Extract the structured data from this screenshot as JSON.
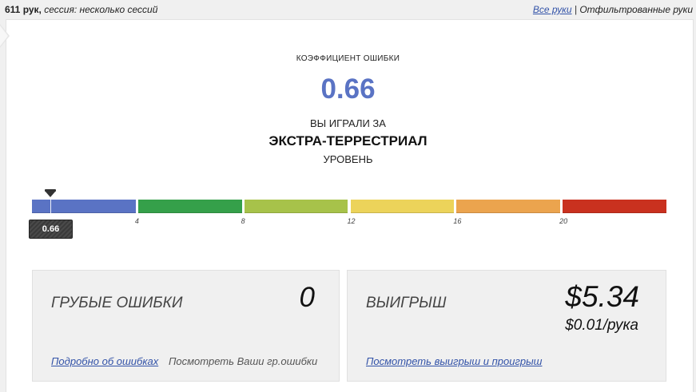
{
  "topbar": {
    "hands_count": "611 рук,",
    "session_info": "сессия: несколько сессий",
    "all_hands_link": "Все руки",
    "separator": "|",
    "filtered_hands": "Отфильтрованные руки"
  },
  "summary": {
    "title": "КОЭФФИЦИЕНТ ОШИБКИ",
    "value": "0.66",
    "played_prefix": "ВЫ ИГРАЛИ ЗА",
    "level": "ЭКСТРА-ТЕРРЕСТРИАЛ",
    "level_suffix": "УРОВЕНЬ"
  },
  "scale": {
    "current_value": 0.66,
    "current_label": "0.66",
    "max": 24,
    "tick_labels": [
      "4",
      "8",
      "12",
      "16",
      "20"
    ],
    "segment_colors": [
      "#5a73c4",
      "#35a04a",
      "#a7c24a",
      "#ecd35a",
      "#eba44e",
      "#c9311f"
    ]
  },
  "cards": {
    "blunders": {
      "label": "ГРУБЫЕ ОШИБКИ",
      "value": "0",
      "link": "Подробно об ошибках",
      "hint": "Посмотреть Ваши гр.ошибки"
    },
    "winnings": {
      "label": "ВЫИГРЫШ",
      "value": "$5.34",
      "per_hand": "$0.01/рука",
      "link": "Посмотреть выигрыш и проигрыш"
    }
  }
}
